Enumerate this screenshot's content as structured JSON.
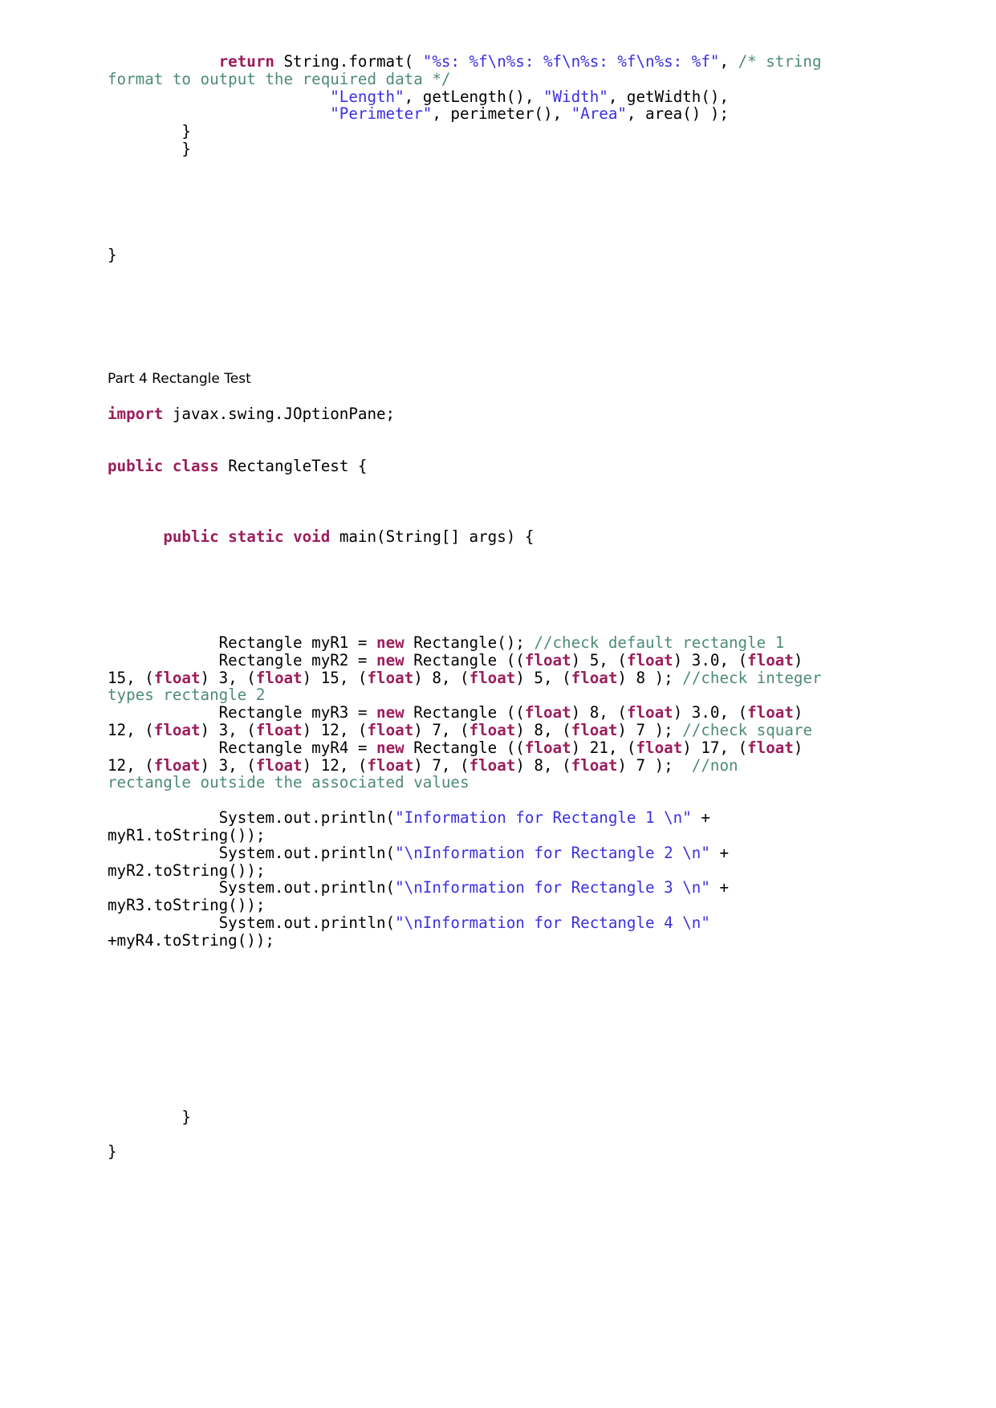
{
  "document": {
    "type": "java-source-listing",
    "colors": {
      "keyword": "#9b1d5c",
      "string": "#3b2fe0",
      "comment": "#4d8b74",
      "plain": "#000000",
      "background": "#ffffff"
    },
    "section_heading": "Part 4 Rectangle Test"
  },
  "top_fragment": {
    "line1": {
      "kw_return": "return",
      "after_return": " String.format( ",
      "format_string": "\"%s: %f\\n%s: %f\\n%s: %f\\n%s: %f\"",
      "comma": ", ",
      "comment_open": "/* string format to output the required data */"
    },
    "line2": {
      "indent": "                        ",
      "s_length": "\"Length\"",
      "mid1": ", getLength(), ",
      "s_width": "\"Width\"",
      "mid2": ", getWidth(),"
    },
    "line3": {
      "indent": "                        ",
      "s_perimeter": "\"Perimeter\"",
      "mid1": ", perimeter(), ",
      "s_area": "\"Area\"",
      "mid2": ", area() );"
    },
    "close_inner": "        }",
    "close_outer": "        }",
    "close_class": "}"
  },
  "test_class": {
    "import_keyword": "import",
    "import_target": " javax.swing.JOptionPane;",
    "class_kw_public": "public",
    "class_kw_class": "class",
    "class_name": " RectangleTest {",
    "main_kw_public": "public",
    "main_kw_static": "static",
    "main_kw_void": "void",
    "main_signature": " main(String[] args) {",
    "declarations": [
      {
        "indent": "            ",
        "head": "Rectangle myR1 = ",
        "kw_new": "new",
        "body": " Rectangle(); ",
        "comment": "//check default rectangle 1"
      }
    ],
    "decl_r2": {
      "indent": "            ",
      "head": "Rectangle myR2 = ",
      "kw_new": "new",
      "args_pre": " Rectangle ((",
      "cast": "float",
      "args": [
        {
          "value": ") 5, ("
        },
        {
          "value": ") 3.0, ("
        },
        {
          "value": ") 15, ("
        },
        {
          "value": ") 3, ("
        },
        {
          "value": ") 15, ("
        },
        {
          "value": ") 8, ("
        },
        {
          "value": ") 5, ("
        },
        {
          "value": ") 8 ); "
        }
      ],
      "comment": "//check integer types rectangle 2"
    },
    "decl_r3": {
      "indent": "            ",
      "head": "Rectangle myR3 = ",
      "kw_new": "new",
      "args_pre": " Rectangle ((",
      "cast": "float",
      "args": [
        {
          "value": ") 8, ("
        },
        {
          "value": ") 3.0, ("
        },
        {
          "value": ") 12, ("
        },
        {
          "value": ") 3, ("
        },
        {
          "value": ") 12, ("
        },
        {
          "value": ") 7, ("
        },
        {
          "value": ") 8, ("
        },
        {
          "value": ") 7 ); "
        }
      ],
      "comment": "//check square"
    },
    "decl_r4": {
      "indent": "            ",
      "head": "Rectangle myR4 = ",
      "kw_new": "new",
      "args_pre": " Rectangle ((",
      "cast": "float",
      "args": [
        {
          "value": ") 21, ("
        },
        {
          "value": ") 17, ("
        },
        {
          "value": ") 12, ("
        },
        {
          "value": ") 3, ("
        },
        {
          "value": ") 12, ("
        },
        {
          "value": ") 7, ("
        },
        {
          "value": ") 8, ("
        },
        {
          "value": ") 7 );  "
        }
      ],
      "comment": "//non rectangle outside the associated values"
    },
    "prints": [
      {
        "indent": "            ",
        "call": "System.out.println(",
        "text": "\"Information for Rectangle 1 \\n\"",
        "tail": " + myR1.toString());"
      },
      {
        "indent": "            ",
        "call": "System.out.println(",
        "text": "\"\\nInformation for Rectangle 2 \\n\"",
        "tail": " + myR2.toString());"
      },
      {
        "indent": "            ",
        "call": "System.out.println(",
        "text": "\"\\nInformation for Rectangle 3 \\n\"",
        "tail": " + myR3.toString());"
      },
      {
        "indent": "            ",
        "call": "System.out.println(",
        "text": "\"\\nInformation for Rectangle 4 \\n\"",
        "tail": " +myR4.toString());"
      }
    ],
    "close_main": "        }",
    "close_class": "}"
  }
}
